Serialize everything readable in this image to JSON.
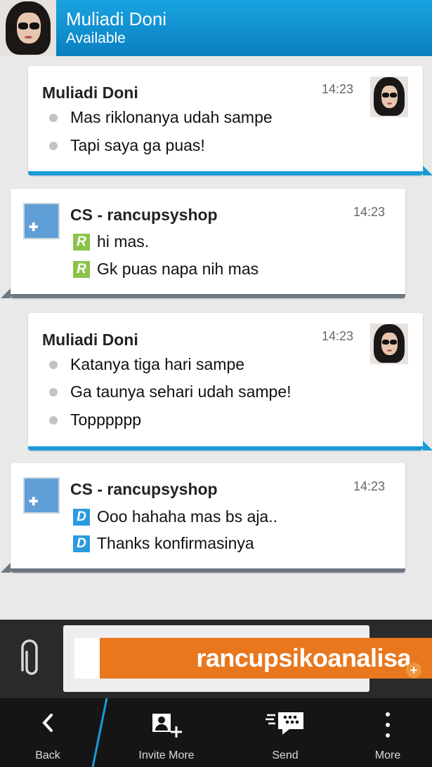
{
  "header": {
    "contact_name": "Muliadi Doni",
    "status": "Available"
  },
  "messages": [
    {
      "sender": "Muliadi Doni",
      "time": "14:23",
      "marker": "dot",
      "lines": [
        "Mas riklonanya udah sampe",
        "Tapi saya ga puas!"
      ]
    },
    {
      "sender": "CS - rancupsyshop",
      "time": "14:23",
      "marker": "R",
      "lines": [
        "hi mas.",
        "Gk puas napa nih mas"
      ]
    },
    {
      "sender": "Muliadi Doni",
      "time": "14:23",
      "marker": "dot",
      "lines": [
        "Katanya tiga hari sampe",
        "Ga taunya sehari udah sampe!",
        "Topppppp"
      ]
    },
    {
      "sender": "CS - rancupsyshop",
      "time": "14:23",
      "marker": "D",
      "lines": [
        "Ooo hahaha mas bs aja..",
        "Thanks konfirmasinya"
      ]
    }
  ],
  "compose": {
    "input_value": "",
    "watermark": "rancupsikoanalisa"
  },
  "actions": {
    "back": "Back",
    "invite": "Invite More",
    "send": "Send",
    "more": "More"
  },
  "colors": {
    "header": "#0a7fc1",
    "outgoing_accent": "#1a9bd7",
    "incoming_accent": "#6d7782",
    "read_badge": "#8bc34a",
    "delivered_badge": "#2b9be0",
    "watermark": "#e8771e"
  }
}
